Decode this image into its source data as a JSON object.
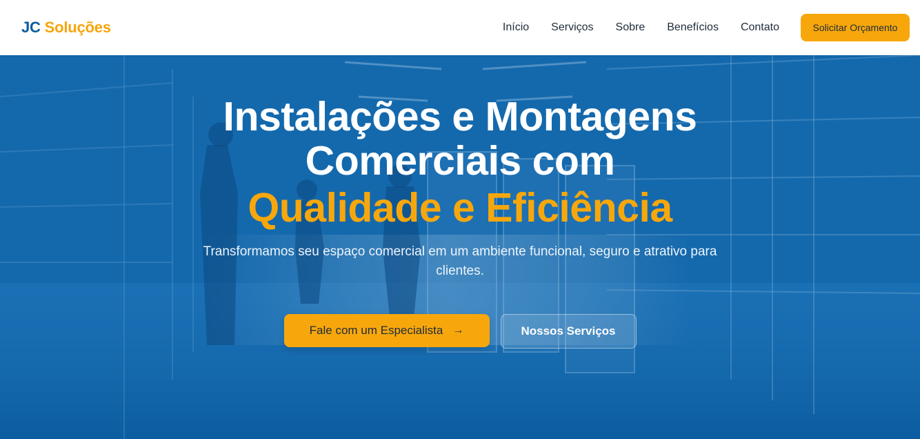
{
  "header": {
    "logo_part1": "JC",
    "logo_part2": "Soluções",
    "nav": [
      "Início",
      "Serviços",
      "Sobre",
      "Benefícios",
      "Contato"
    ],
    "cta_label": "Solicitar Orçamento"
  },
  "hero": {
    "title_line1": "Instalações e Montagens",
    "title_line2": "Comerciais com",
    "title_highlight": "Qualidade e Eficiência",
    "subtitle": "Transformamos seu espaço comercial em um ambiente funcional, seguro e atrativo para clientes.",
    "primary_button": "Fale com um Especialista",
    "primary_button_icon": "arrow-right-icon",
    "secondary_button": "Nossos Serviços"
  },
  "colors": {
    "brand_blue": "#0a5c9e",
    "accent_orange": "#f7a70c",
    "hero_overlay": "#0b5fa5"
  }
}
